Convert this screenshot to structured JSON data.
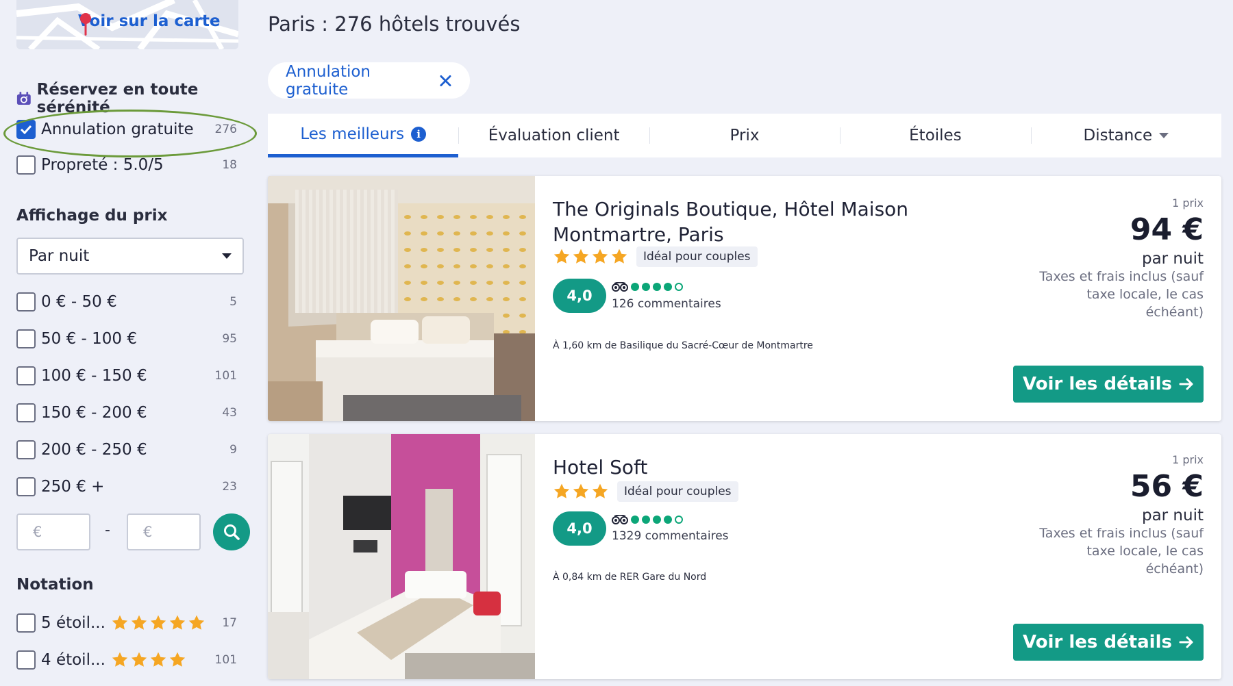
{
  "sidebar": {
    "map_link": "Voir sur la carte",
    "serenity_title": "Réservez en toute sérénité",
    "free_cancellation": {
      "label": "Annulation gratuite",
      "count": "276",
      "checked": true
    },
    "cleanliness": {
      "label": "Propreté : 5.0/5",
      "count": "18",
      "checked": false
    },
    "price_display_title": "Affichage du prix",
    "price_display_value": "Par nuit",
    "price_ranges": [
      {
        "label": "0 € - 50 €",
        "count": "5"
      },
      {
        "label": "50 € - 100 €",
        "count": "95"
      },
      {
        "label": "100 € - 150 €",
        "count": "101"
      },
      {
        "label": "150 € - 200 €",
        "count": "43"
      },
      {
        "label": "200 € - 250 €",
        "count": "9"
      },
      {
        "label": "250 € +",
        "count": "23"
      }
    ],
    "min_price_placeholder": "€",
    "max_price_placeholder": "€",
    "range_separator": "-",
    "rating_title": "Notation",
    "ratings": [
      {
        "label": "5 étoil...",
        "stars": 5,
        "count": "17"
      },
      {
        "label": "4 étoil...",
        "stars": 4,
        "count": "101"
      }
    ]
  },
  "main": {
    "results_title": "Paris : 276 hôtels trouvés",
    "active_filter_chip": "Annulation gratuite",
    "tabs": [
      {
        "label": "Les meilleurs",
        "active": true
      },
      {
        "label": "Évaluation client",
        "active": false
      },
      {
        "label": "Prix",
        "active": false
      },
      {
        "label": "Étoiles",
        "active": false
      },
      {
        "label": "Distance",
        "active": false
      }
    ],
    "hotels": [
      {
        "name": "The Originals Boutique, Hôtel Maison Montmartre, Paris",
        "stars": 4,
        "badge": "Idéal pour couples",
        "score": "4,0",
        "ta_rating": 4,
        "reviews": "126 commentaires",
        "distance": "À 1,60 km de Basilique du Sacré-Cœur de Montmartre",
        "price_count": "1 prix",
        "price": "94 €",
        "per_night": "par nuit",
        "taxes": "Taxes et frais inclus (sauf taxe locale, le cas échéant)",
        "button": "Voir les détails"
      },
      {
        "name": "Hotel Soft",
        "stars": 3,
        "badge": "Idéal pour couples",
        "score": "4,0",
        "ta_rating": 4,
        "reviews": "1329 commentaires",
        "distance": "À 0,84 km de RER Gare du Nord",
        "price_count": "1 prix",
        "price": "56 €",
        "per_night": "par nuit",
        "taxes": "Taxes et frais inclus (sauf taxe locale, le cas échéant)",
        "button": "Voir les détails"
      }
    ]
  },
  "colors": {
    "brand_blue": "#1d5fd0",
    "teal": "#139a86",
    "star": "#f5a623",
    "tripadvisor_green": "#0ca678",
    "highlight_oval": "#6b9a3a"
  }
}
